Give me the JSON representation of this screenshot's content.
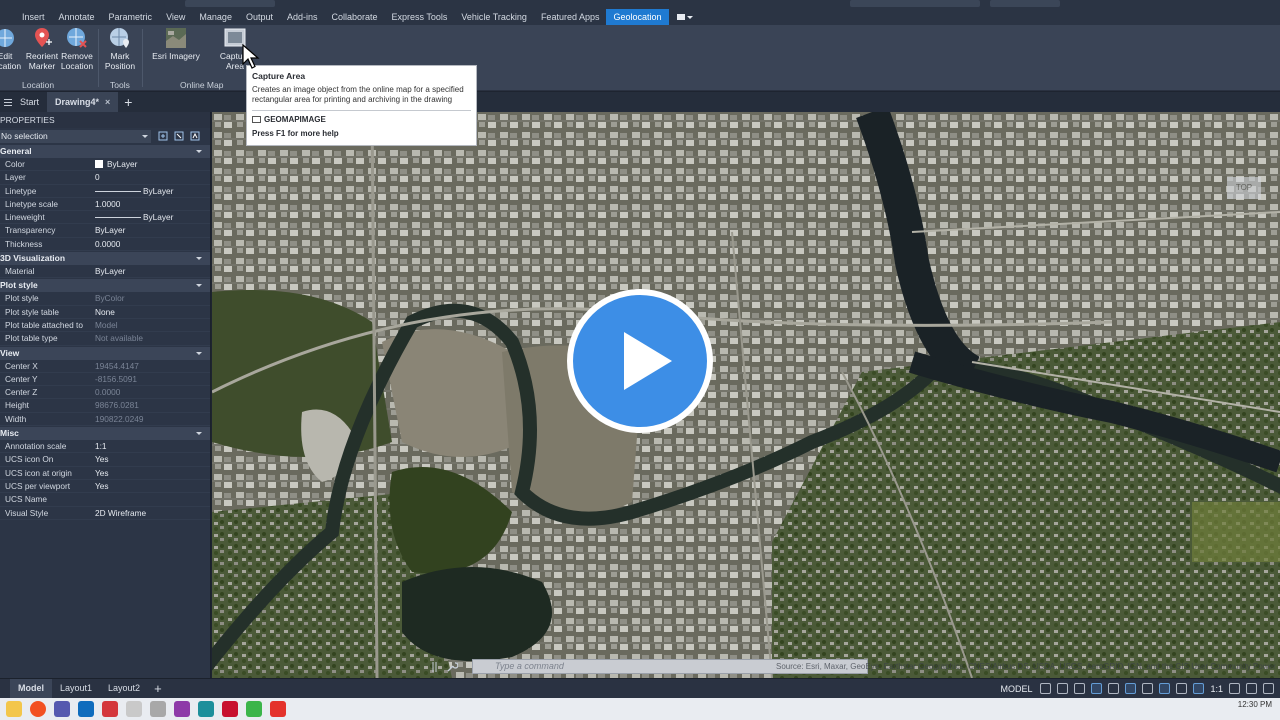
{
  "ribbon_tabs": [
    "Insert",
    "Annotate",
    "Parametric",
    "View",
    "Manage",
    "Output",
    "Add-ins",
    "Collaborate",
    "Express Tools",
    "Vehicle Tracking",
    "Featured Apps",
    "Geolocation"
  ],
  "ribbon": {
    "buttons": {
      "edit_location": "Edit\nLocation",
      "reorient_marker": "Reorient\nMarker",
      "remove_location": "Remove\nLocation",
      "mark_position": "Mark\nPosition",
      "esri_imagery": "Esri Imagery",
      "capture_area": "Capture\nArea"
    },
    "groups": {
      "location": "Location",
      "tools": "Tools",
      "online_map": "Online Map"
    }
  },
  "tooltip": {
    "title": "Capture Area",
    "description": "Creates an image object from the online map for a specified rectangular area for printing and archiving in the drawing",
    "command": "GEOMAPIMAGE",
    "help": "Press F1 for more help"
  },
  "file_tabs": {
    "start": "Start",
    "drawing": "Drawing4*",
    "close": "×",
    "plus": "+"
  },
  "properties": {
    "title": "PROPERTIES",
    "selection": "No selection",
    "categories": {
      "general": "General",
      "visualization": "3D Visualization",
      "plot_style": "Plot style",
      "view": "View",
      "misc": "Misc"
    },
    "general": [
      {
        "key": "Color",
        "value": "ByLayer"
      },
      {
        "key": "Layer",
        "value": "0"
      },
      {
        "key": "Linetype",
        "value": "ByLayer"
      },
      {
        "key": "Linetype scale",
        "value": "1.0000"
      },
      {
        "key": "Lineweight",
        "value": "ByLayer"
      },
      {
        "key": "Transparency",
        "value": "ByLayer"
      },
      {
        "key": "Thickness",
        "value": "0.0000"
      }
    ],
    "visualization": [
      {
        "key": "Material",
        "value": "ByLayer"
      }
    ],
    "plot_style": [
      {
        "key": "Plot style",
        "value": "ByColor"
      },
      {
        "key": "Plot style table",
        "value": "None"
      },
      {
        "key": "Plot table attached to",
        "value": "Model"
      },
      {
        "key": "Plot table type",
        "value": "Not available"
      }
    ],
    "view": [
      {
        "key": "Center X",
        "value": "19454.4147"
      },
      {
        "key": "Center Y",
        "value": "-8156.5091"
      },
      {
        "key": "Center Z",
        "value": "0.0000"
      },
      {
        "key": "Height",
        "value": "98676.0281"
      },
      {
        "key": "Width",
        "value": "190822.0249"
      }
    ],
    "misc": [
      {
        "key": "Annotation scale",
        "value": "1:1"
      },
      {
        "key": "UCS icon On",
        "value": "Yes"
      },
      {
        "key": "UCS icon at origin",
        "value": "Yes"
      },
      {
        "key": "UCS per viewport",
        "value": "Yes"
      },
      {
        "key": "UCS Name",
        "value": ""
      },
      {
        "key": "Visual Style",
        "value": "2D Wireframe"
      }
    ]
  },
  "viewport": {
    "command_placeholder": "Type a command",
    "attribution": "Source: Esri, Maxar, GeoEye, Earthstar Geographics, CNES/Airbus DS, USDA, USGS, AeroGRID, IGN, and the GIS User Community Powered by Esri",
    "viewcube_label": "TOP"
  },
  "layout_tabs": [
    "Model",
    "Layout1",
    "Layout2"
  ],
  "layout_plus": "+",
  "status": {
    "model": "MODEL",
    "scale": "1:1"
  },
  "clock": {
    "time": "12:30 PM"
  },
  "colors": {
    "accent": "#1f7ad1",
    "play": "#3d8ee6"
  }
}
